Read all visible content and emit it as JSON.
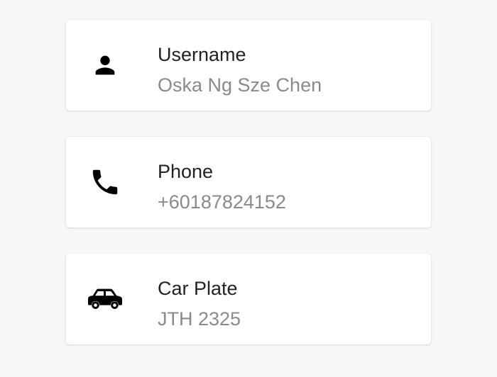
{
  "profile": {
    "fields": [
      {
        "icon": "person-icon",
        "label": "Username",
        "value": "Oska Ng Sze Chen"
      },
      {
        "icon": "phone-icon",
        "label": "Phone",
        "value": "+60187824152"
      },
      {
        "icon": "car-icon",
        "label": "Car Plate",
        "value": "JTH 2325"
      }
    ]
  },
  "colors": {
    "background": "#f7f7f7",
    "card": "#ffffff",
    "label": "#222222",
    "value": "#8a8a8a",
    "icon": "#000000"
  }
}
